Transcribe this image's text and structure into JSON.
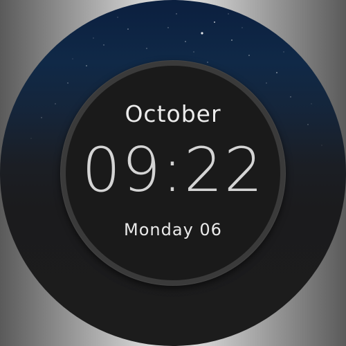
{
  "watch_face": {
    "month": "October",
    "time": "09:22",
    "day_date": "Monday 06"
  },
  "colors": {
    "sky_top": "#0b1f3f",
    "face_background": "#1a1a1a",
    "face_border": "#3a3a3a",
    "text": "#e0e0e0"
  }
}
